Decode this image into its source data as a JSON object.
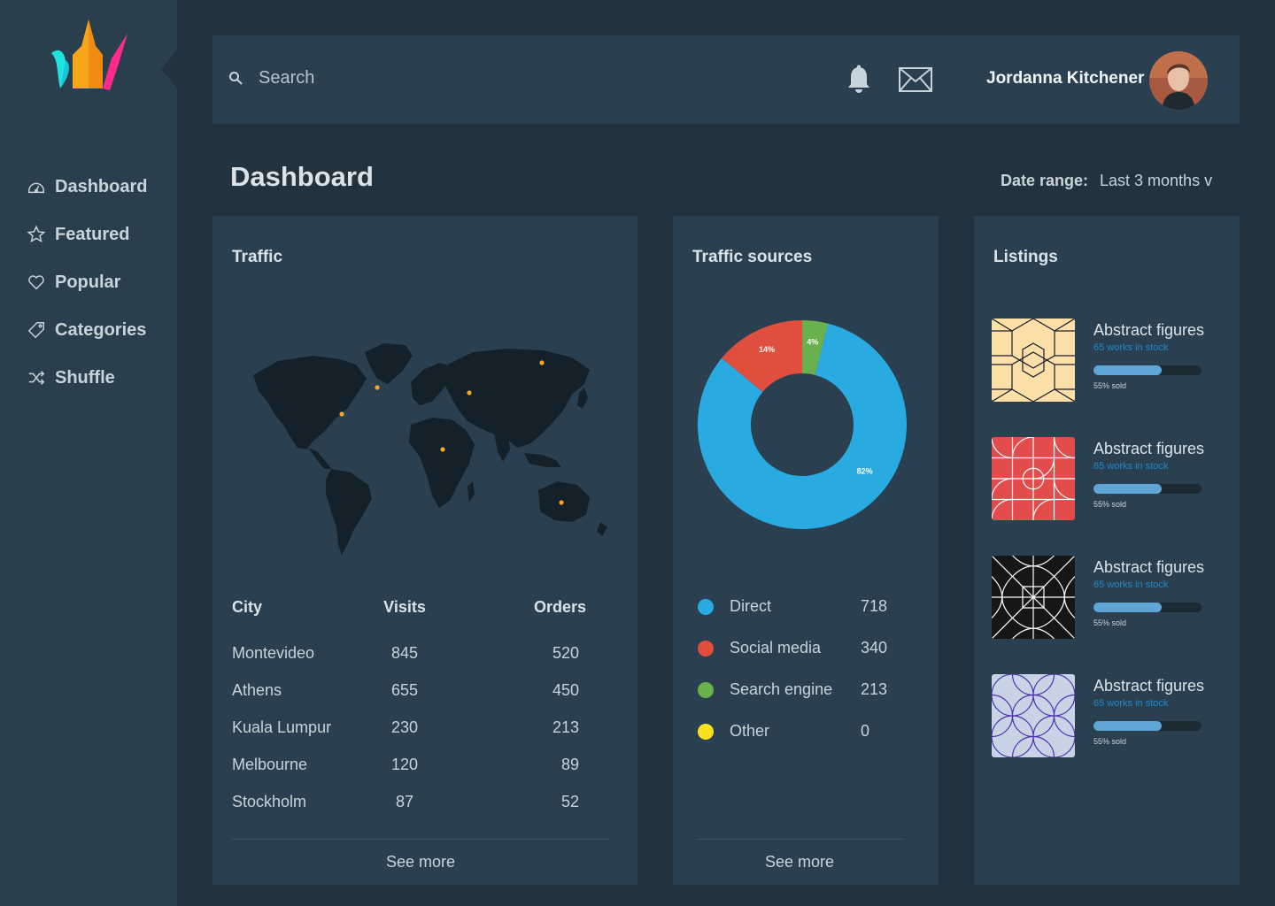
{
  "sidebar": {
    "items": [
      {
        "label": "Dashboard",
        "icon": "dashboard-icon"
      },
      {
        "label": "Featured",
        "icon": "star-icon"
      },
      {
        "label": "Popular",
        "icon": "heart-icon"
      },
      {
        "label": "Categories",
        "icon": "tag-icon"
      },
      {
        "label": "Shuffle",
        "icon": "shuffle-icon"
      }
    ]
  },
  "header": {
    "search_placeholder": "Search",
    "user_name": "Jordanna Kitchener"
  },
  "page": {
    "title": "Dashboard",
    "date_range_label": "Date range:",
    "date_range_value": "Last 3 months v"
  },
  "traffic": {
    "title": "Traffic",
    "columns": [
      "City",
      "Visits",
      "Orders"
    ],
    "rows": [
      [
        "Montevideo",
        "845",
        "520"
      ],
      [
        "Athens",
        "655",
        "450"
      ],
      [
        "Kuala Lumpur",
        "230",
        "213"
      ],
      [
        "Melbourne",
        "120",
        "89"
      ],
      [
        "Stockholm",
        "87",
        "52"
      ]
    ],
    "see_more": "See more"
  },
  "sources": {
    "title": "Traffic sources",
    "see_more": "See more",
    "legend": [
      {
        "label": "Direct",
        "value": "718",
        "color": "#29abe2"
      },
      {
        "label": "Social media",
        "value": "340",
        "color": "#e04e3e"
      },
      {
        "label": "Search engine",
        "value": "213",
        "color": "#6ab04c"
      },
      {
        "label": "Other",
        "value": "0",
        "color": "#f9e11e"
      }
    ]
  },
  "chart_data": {
    "type": "pie",
    "categories": [
      "Direct",
      "Social media",
      "Search engine"
    ],
    "values": [
      82,
      14,
      4
    ],
    "labels": [
      "82%",
      "14%",
      "4%"
    ],
    "colors": [
      "#29abe2",
      "#e04e3e",
      "#6ab04c"
    ]
  },
  "listings": {
    "title": "Listings",
    "items": [
      {
        "name": "Abstract figures",
        "stock": "65 works in stock",
        "sold": "55% sold",
        "progress": 0.63,
        "pattern": "hexagon"
      },
      {
        "name": "Abstract figures",
        "stock": "65 works in stock",
        "sold": "55% sold",
        "progress": 0.63,
        "pattern": "arcs"
      },
      {
        "name": "Abstract figures",
        "stock": "65 works in stock",
        "sold": "55% sold",
        "progress": 0.63,
        "pattern": "diamonds"
      },
      {
        "name": "Abstract figures",
        "stock": "65 works in stock",
        "sold": "55% sold",
        "progress": 0.63,
        "pattern": "circles"
      }
    ]
  },
  "colors": {
    "background": "#22333f",
    "panel": "#2a4050",
    "sidebar": "#2a3f4d",
    "accent_blue": "#29abe2",
    "map_land": "#15212a",
    "map_marker": "#f5a623"
  }
}
